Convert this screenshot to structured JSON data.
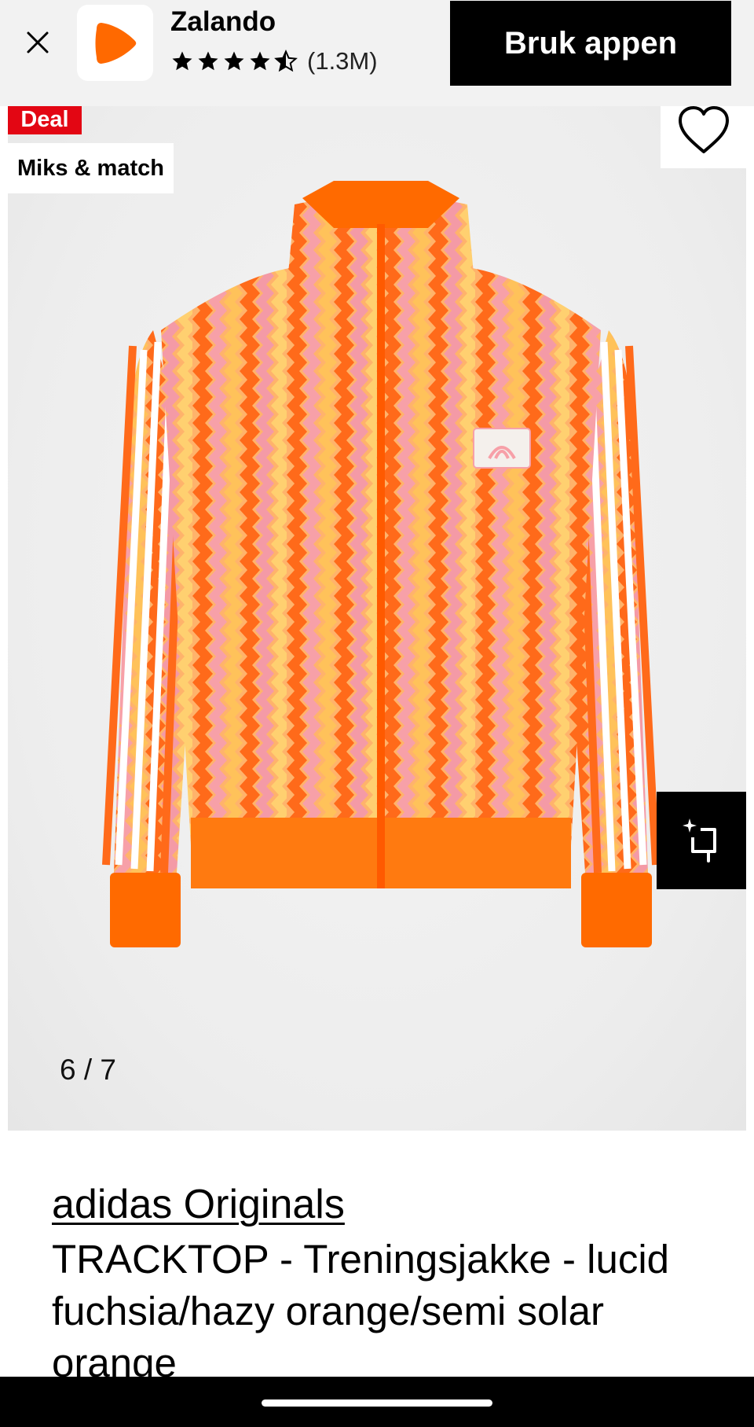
{
  "banner": {
    "close_icon": "close-icon",
    "app_name": "Zalando",
    "rating_stars": 4.5,
    "rating_count": "(1.3M)",
    "cta_label": "Bruk appen",
    "brand_color": "#ff6900"
  },
  "gallery": {
    "deal_badge": "Deal",
    "mix_badge": "Miks & match",
    "wishlist_icon": "heart-icon",
    "ar_icon": "sparkle-crop-icon",
    "counter": "6 / 7",
    "deal_color": "#e30613"
  },
  "product": {
    "brand": "adidas Originals",
    "title": "TRACKTOP - Treningsjakke - lucid fuchsia/hazy orange/semi solar orange"
  }
}
